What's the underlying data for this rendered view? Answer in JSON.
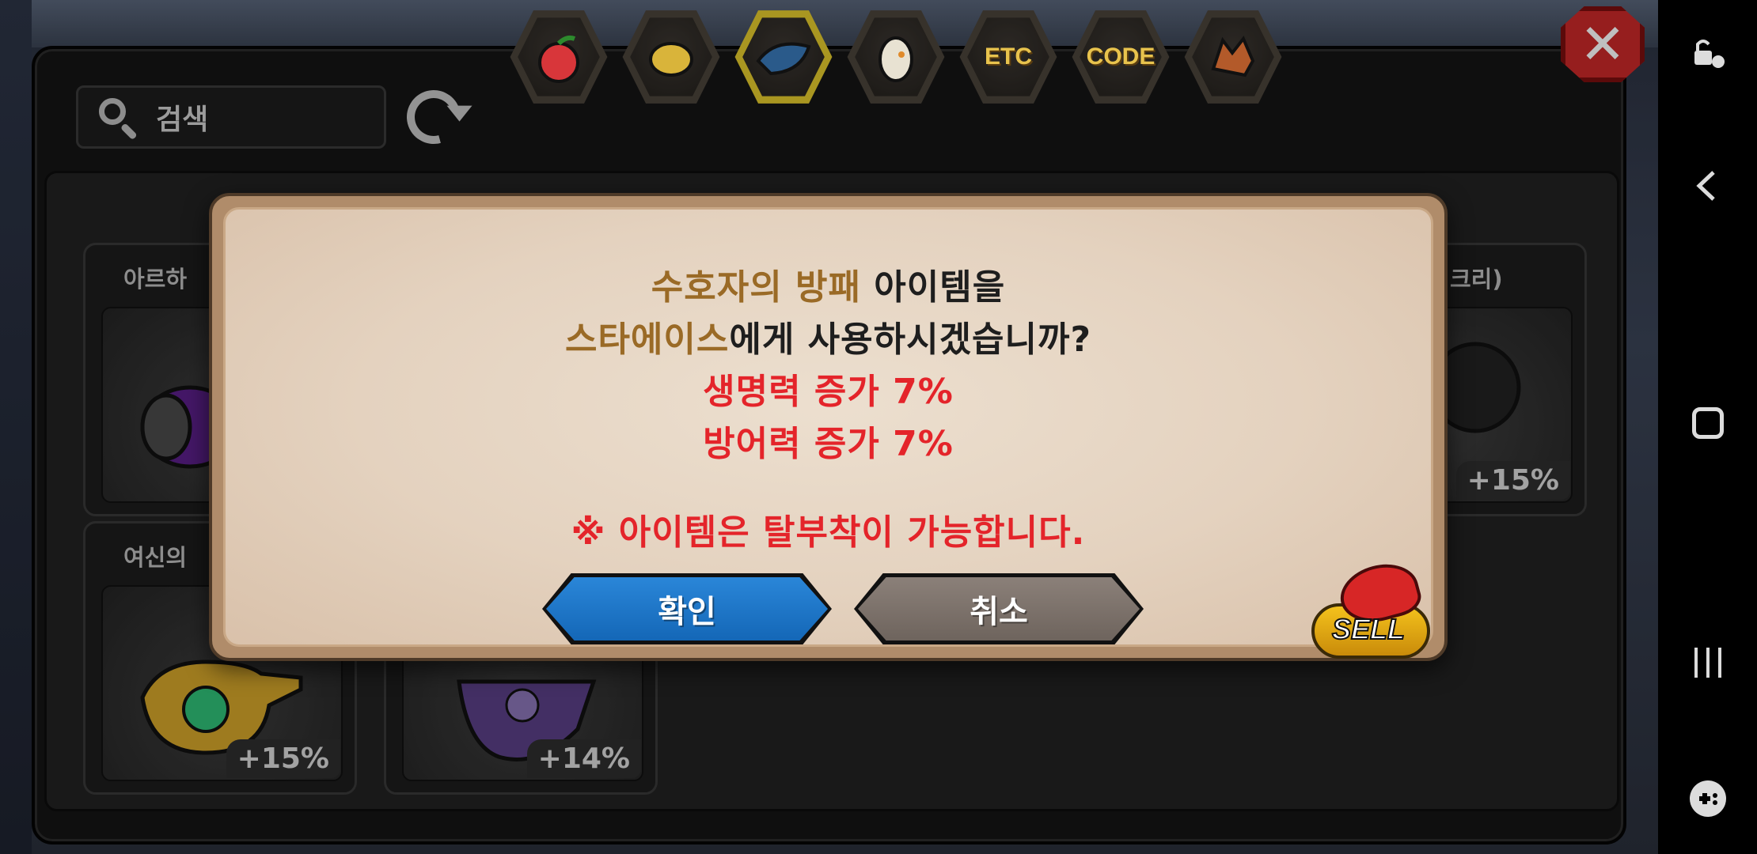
{
  "search": {
    "placeholder": "검색"
  },
  "tabs": [
    {
      "label": "",
      "icon": "fruit-icon"
    },
    {
      "label": "",
      "icon": "gold-nugget-icon"
    },
    {
      "label": "",
      "icon": "dragon-scale-icon",
      "active": true
    },
    {
      "label": "",
      "icon": "egg-icon"
    },
    {
      "label": "ETC",
      "icon": ""
    },
    {
      "label": "CODE",
      "icon": ""
    },
    {
      "label": "",
      "icon": "dragon-head-icon"
    }
  ],
  "cards": [
    {
      "name": "아르하",
      "pct": ""
    },
    {
      "name": "여신의",
      "pct": "+15%"
    },
    {
      "name": "",
      "pct": "+14%"
    },
    {
      "name": "크리)",
      "pct": "+15%"
    }
  ],
  "dialog": {
    "line1_highlight": "수호자의 방패",
    "line1_rest": " 아이템을",
    "line2_highlight": "스타에이스",
    "line2_rest": "에게 사용하시겠습니까?",
    "stat1": "생명력 증가 7%",
    "stat2": "방어력 증가 7%",
    "note": "※ 아이템은 탈부착이 가능합니다.",
    "confirm_label": "확인",
    "cancel_label": "취소",
    "sell_label": "SELL"
  },
  "colors": {
    "highlight": "#9a6a26",
    "stat_red": "#e4242a",
    "confirm_blue": "#1467b7",
    "cancel_gray": "#6e645d",
    "active_tab": "#e2c92c"
  }
}
